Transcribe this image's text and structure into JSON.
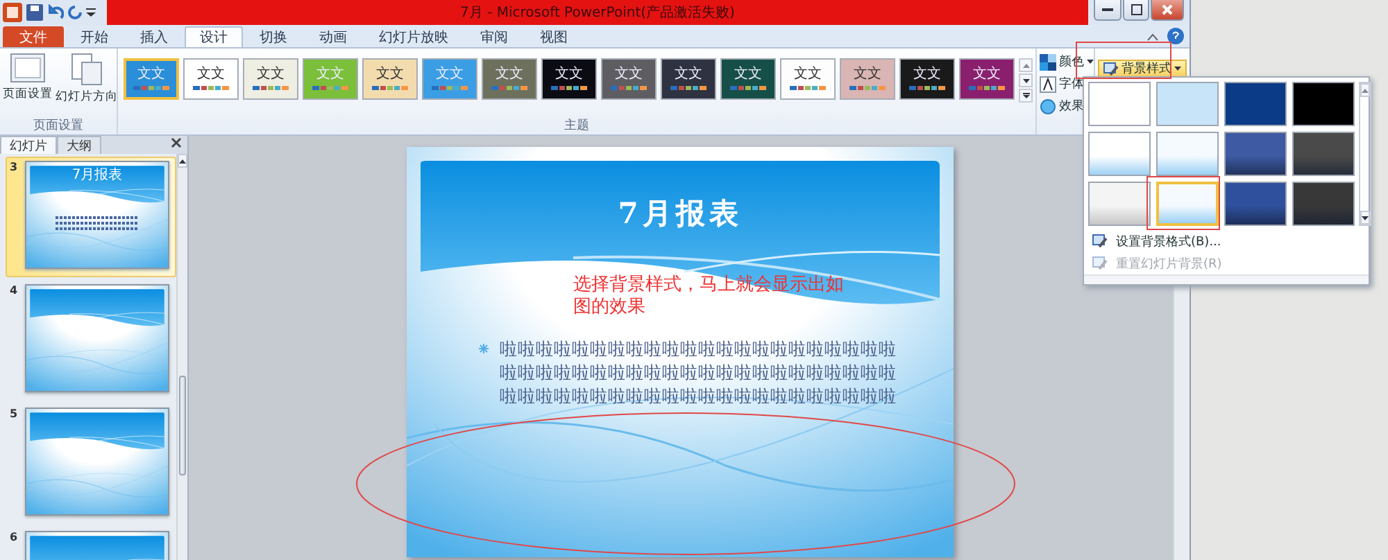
{
  "window": {
    "title": "7月 - Microsoft PowerPoint(产品激活失败)"
  },
  "ribbon_tabs": [
    {
      "label": "文件",
      "kind": "file",
      "selected": false
    },
    {
      "label": "开始",
      "kind": "tab",
      "selected": false
    },
    {
      "label": "插入",
      "kind": "tab",
      "selected": false
    },
    {
      "label": "设计",
      "kind": "tab",
      "selected": true
    },
    {
      "label": "切换",
      "kind": "tab",
      "selected": false
    },
    {
      "label": "动画",
      "kind": "tab",
      "selected": false
    },
    {
      "label": "幻灯片放映",
      "kind": "tab",
      "selected": false
    },
    {
      "label": "审阅",
      "kind": "tab",
      "selected": false
    },
    {
      "label": "视图",
      "kind": "tab",
      "selected": false
    }
  ],
  "page_setup_group": {
    "label": "页面设置",
    "buttons": [
      {
        "label": "页面设置",
        "kind": "page"
      },
      {
        "label": "幻灯片方向",
        "kind": "orientation"
      }
    ]
  },
  "themes_group": {
    "label": "主题",
    "themes": [
      {
        "label": "文文",
        "color": "#2a8ed8",
        "selected": true
      },
      {
        "label": "文文",
        "color": "#ffffff",
        "selected": false
      },
      {
        "label": "文文",
        "color": "#efeee2",
        "selected": false
      },
      {
        "label": "文文",
        "color": "#7bbf3a",
        "selected": false
      },
      {
        "label": "文文",
        "color": "#f2dcae",
        "selected": false
      },
      {
        "label": "文文",
        "color": "#3b9ee4",
        "selected": false
      },
      {
        "label": "文文",
        "color": "#6e705e",
        "selected": false
      },
      {
        "label": "文文",
        "color": "#0b0b14",
        "selected": false
      },
      {
        "label": "文文",
        "color": "#5e5e62",
        "selected": false
      },
      {
        "label": "文文",
        "color": "#2f3240",
        "selected": false
      },
      {
        "label": "文文",
        "color": "#164f48",
        "selected": false
      },
      {
        "label": "文文",
        "color": "#fdfdfd",
        "selected": false
      },
      {
        "label": "文文",
        "color": "#d9b5b3",
        "selected": false
      },
      {
        "label": "文文",
        "color": "#1a1a1a",
        "selected": false
      },
      {
        "label": "文文",
        "color": "#8a1f6e",
        "selected": false
      }
    ]
  },
  "theme_options": [
    {
      "label": "颜色",
      "kind": "colors"
    },
    {
      "label": "字体",
      "kind": "fonts"
    },
    {
      "label": "效果",
      "kind": "effects"
    }
  ],
  "background_styles": {
    "label": "背景样式",
    "expanded": true,
    "styles": [
      {
        "color": "#ffffff",
        "kind": "solid",
        "selected": false
      },
      {
        "color": "#c8e4f8",
        "kind": "solid",
        "selected": false
      },
      {
        "color": "#0b3b86",
        "kind": "solid",
        "selected": false
      },
      {
        "color": "#000000",
        "kind": "solid",
        "selected": false
      },
      {
        "color": "#ffffff",
        "kind": "gradient",
        "selected": false
      },
      {
        "color": "#f4faff",
        "kind": "gradient",
        "selected": false
      },
      {
        "color": "#3d5aa2",
        "kind": "gradient",
        "selected": false
      },
      {
        "color": "#4a4a4a",
        "kind": "gradient",
        "selected": false
      },
      {
        "color": "#f4f4f4",
        "kind": "gradient",
        "selected": false
      },
      {
        "color": "#f4faff",
        "kind": "gradient",
        "selected": true
      },
      {
        "color": "#2f509c",
        "kind": "gradient",
        "selected": false
      },
      {
        "color": "#383838",
        "kind": "gradient",
        "selected": false
      }
    ],
    "menu": [
      {
        "label": "设置背景格式(B)...",
        "disabled": false
      },
      {
        "label": "重置幻灯片背景(R)",
        "disabled": true
      }
    ]
  },
  "panel_tabs": [
    {
      "label": "幻灯片",
      "selected": true
    },
    {
      "label": "大纲",
      "selected": false
    }
  ],
  "slides": [
    {
      "number": "3",
      "title": "7月报表",
      "selected": true
    },
    {
      "number": "4",
      "selected": false
    },
    {
      "number": "5",
      "selected": false
    },
    {
      "number": "6",
      "selected": false
    }
  ],
  "slide": {
    "title": "7月报表",
    "note": "选择背景样式，马上就会显示出如图的效果",
    "bullet": "啦啦啦啦啦啦啦啦啦啦啦啦啦啦啦啦啦啦啦啦啦啦啦啦啦啦啦啦啦啦啦啦啦啦啦啦啦啦啦啦啦啦啦啦啦啦啦啦啦啦啦啦啦啦啦啦啦啦啦啦啦啦啦啦啦啦"
  }
}
